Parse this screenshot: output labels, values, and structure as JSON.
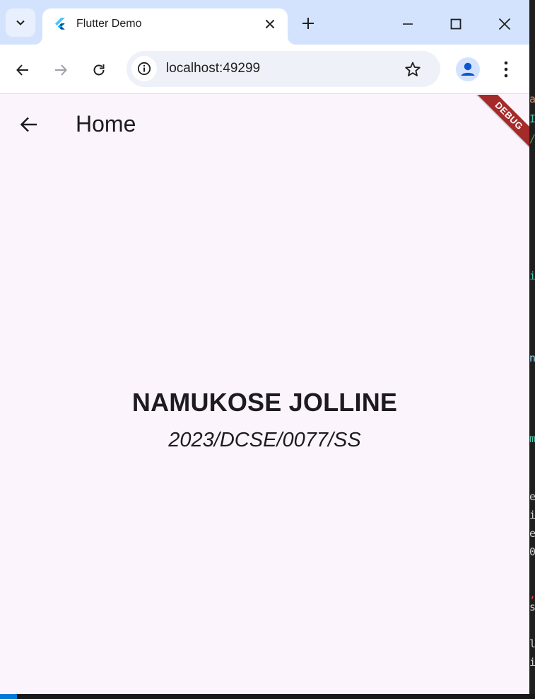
{
  "browser": {
    "tab": {
      "title": "Flutter Demo"
    },
    "address": {
      "url": "localhost:49299"
    },
    "icons": {
      "tab_search": "chevron-down-icon",
      "favicon": "flutter-logo-icon",
      "tab_close": "close-icon",
      "new_tab": "plus-icon",
      "minimize": "minimize-icon",
      "maximize": "maximize-icon",
      "close_window": "close-icon",
      "back": "arrow-left-icon",
      "forward": "arrow-right-icon",
      "reload": "reload-icon",
      "site_info": "info-icon",
      "bookmark": "star-icon",
      "profile": "person-icon",
      "menu": "more-vertical-icon"
    }
  },
  "app": {
    "appbar": {
      "title": "Home",
      "back_icon": "arrow-left-icon"
    },
    "debug_banner": "DEBUG",
    "content": {
      "name": "NAMUKOSE JOLLINE",
      "reg_number": "2023/DCSE/0077/SS"
    }
  },
  "colors": {
    "tabstrip": "#d3e3fd",
    "app_background": "#fcf4fc",
    "debug_banner": "#a52a2a",
    "text": "#1d1b20",
    "profile_icon": "#0b57d0"
  }
}
